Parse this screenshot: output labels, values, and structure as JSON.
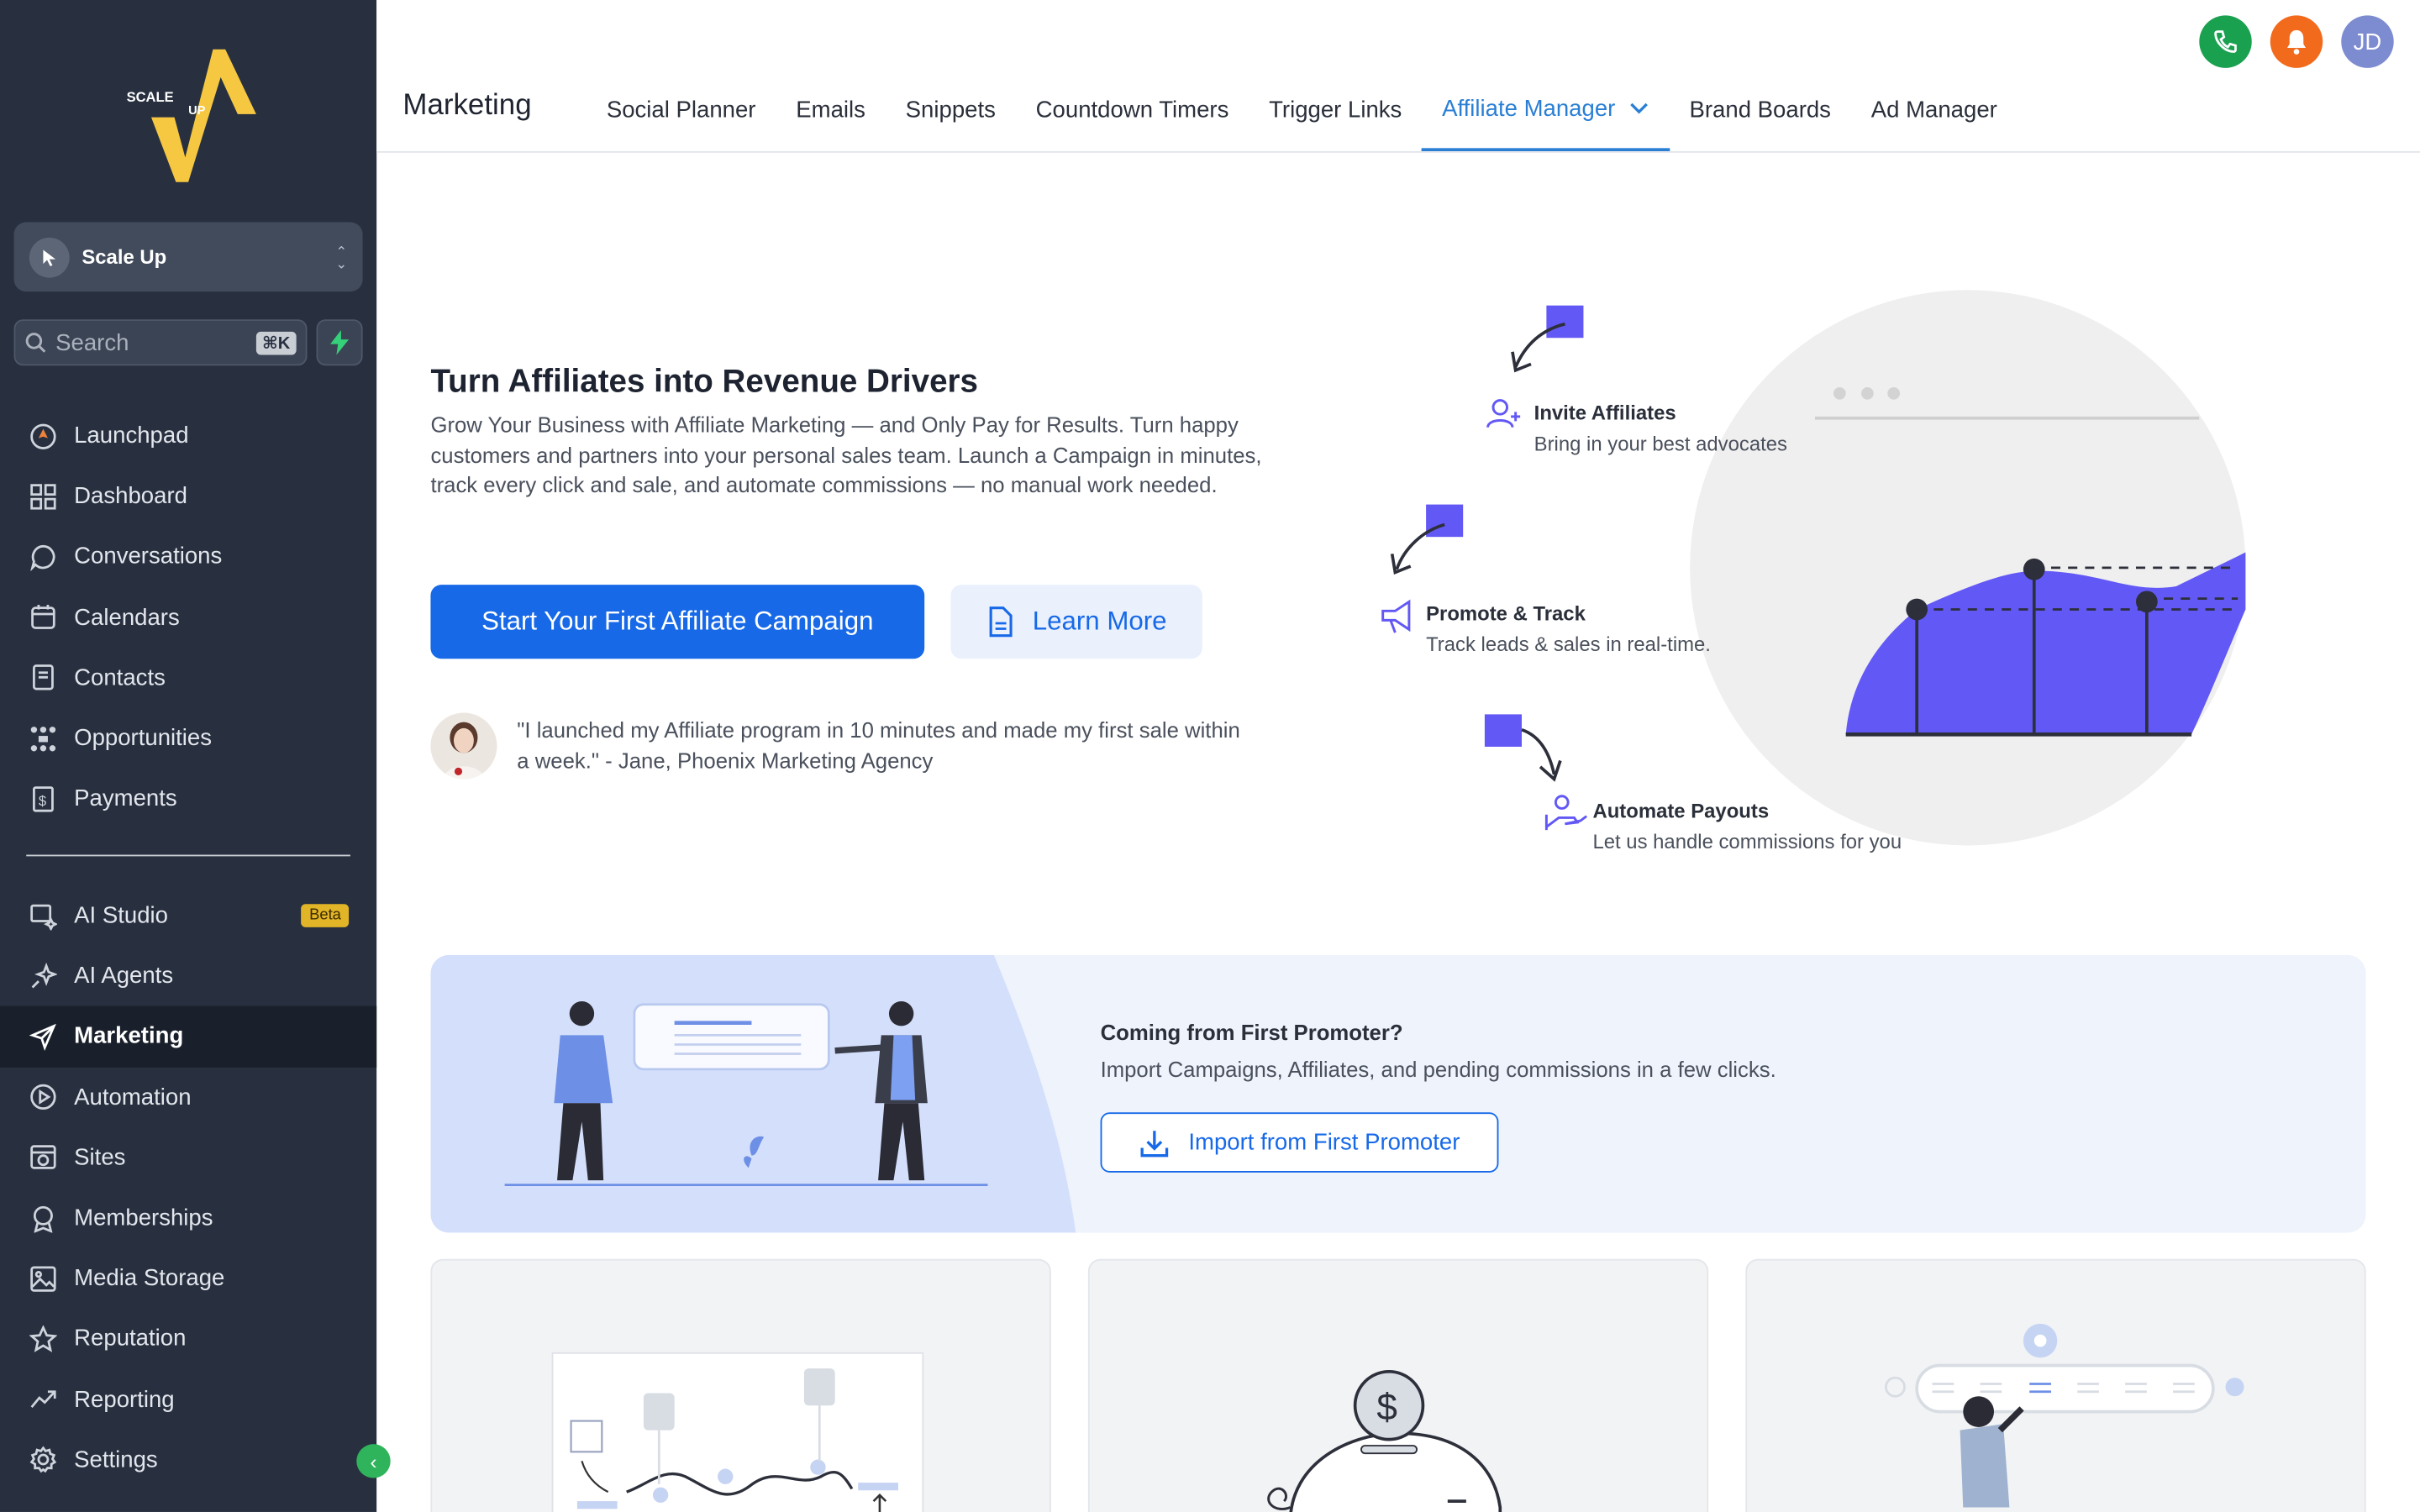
{
  "sidebar": {
    "location": "Scale Up",
    "search_placeholder": "Search",
    "search_shortcut": "⌘K",
    "items": [
      {
        "label": "Launchpad",
        "icon": "rocket-icon"
      },
      {
        "label": "Dashboard",
        "icon": "grid-icon"
      },
      {
        "label": "Conversations",
        "icon": "chat-icon"
      },
      {
        "label": "Calendars",
        "icon": "calendar-icon"
      },
      {
        "label": "Contacts",
        "icon": "contacts-icon"
      },
      {
        "label": "Opportunities",
        "icon": "opportunities-icon"
      },
      {
        "label": "Payments",
        "icon": "payments-icon"
      }
    ],
    "items2": [
      {
        "label": "AI Studio",
        "icon": "ai-studio-icon",
        "badge": "Beta"
      },
      {
        "label": "AI Agents",
        "icon": "sparkle-icon"
      },
      {
        "label": "Marketing",
        "icon": "send-icon"
      },
      {
        "label": "Automation",
        "icon": "automation-icon"
      },
      {
        "label": "Sites",
        "icon": "sites-icon"
      },
      {
        "label": "Memberships",
        "icon": "badge-icon"
      },
      {
        "label": "Media Storage",
        "icon": "image-icon"
      },
      {
        "label": "Reputation",
        "icon": "star-icon"
      },
      {
        "label": "Reporting",
        "icon": "trend-icon"
      },
      {
        "label": "Settings",
        "icon": "gear-icon"
      }
    ]
  },
  "header": {
    "title": "Marketing",
    "tabs": [
      "Social Planner",
      "Emails",
      "Snippets",
      "Countdown Timers",
      "Trigger Links",
      "Affiliate Manager",
      "Brand Boards",
      "Ad Manager"
    ],
    "avatar_initials": "JD",
    "colors": {
      "phone": "#1aa150",
      "bell": "#f26a1b",
      "avatar": "#7d8bd0"
    }
  },
  "hero": {
    "title": "Turn Affiliates into Revenue Drivers",
    "description": "Grow Your Business with Affiliate Marketing — and Only Pay for Results. Turn happy customers and partners into your personal sales team. Launch a Campaign in minutes, track every click and sale, and automate commissions — no manual work needed.",
    "primary_cta": "Start Your First Affiliate Campaign",
    "secondary_cta": "Learn More",
    "testimonial": "\"I launched my Affiliate program in 10 minutes and made my first sale within a week.\" - Jane, Phoenix Marketing Agency"
  },
  "steps": [
    {
      "title": "Invite Affiliates",
      "desc": "Bring in your best advocates"
    },
    {
      "title": "Promote & Track",
      "desc": "Track leads & sales in real-time."
    },
    {
      "title": "Automate Payouts",
      "desc": "Let us handle commissions for you"
    }
  ],
  "banner": {
    "title": "Coming from First Promoter?",
    "desc": "Import Campaigns, Affiliates, and pending commissions in a few clicks.",
    "cta": "Import from First Promoter"
  },
  "accent": "#1769e8"
}
